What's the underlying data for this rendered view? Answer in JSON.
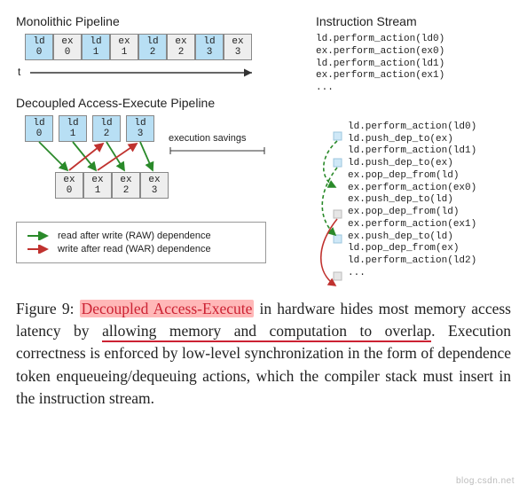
{
  "monolithic": {
    "title": "Monolithic Pipeline",
    "cells": [
      {
        "op": "ld",
        "idx": "0",
        "style": "blue"
      },
      {
        "op": "ex",
        "idx": "0",
        "style": "gray"
      },
      {
        "op": "ld",
        "idx": "1",
        "style": "blue"
      },
      {
        "op": "ex",
        "idx": "1",
        "style": "gray"
      },
      {
        "op": "ld",
        "idx": "2",
        "style": "blue"
      },
      {
        "op": "ex",
        "idx": "2",
        "style": "gray"
      },
      {
        "op": "ld",
        "idx": "3",
        "style": "blue"
      },
      {
        "op": "ex",
        "idx": "3",
        "style": "gray"
      }
    ],
    "time_label": "t"
  },
  "istream": {
    "title": "Instruction Stream",
    "lines": [
      "ld.perform_action(ld0)",
      "ex.perform_action(ex0)",
      "ld.perform_action(ld1)",
      "ex.perform_action(ex1)",
      "..."
    ]
  },
  "dae": {
    "title": "Decoupled Access-Execute Pipeline",
    "ld_cells": [
      {
        "op": "ld",
        "idx": "0"
      },
      {
        "op": "ld",
        "idx": "1"
      },
      {
        "op": "ld",
        "idx": "2"
      },
      {
        "op": "ld",
        "idx": "3"
      }
    ],
    "ex_cells": [
      {
        "op": "ex",
        "idx": "0"
      },
      {
        "op": "ex",
        "idx": "1"
      },
      {
        "op": "ex",
        "idx": "2"
      },
      {
        "op": "ex",
        "idx": "3"
      }
    ],
    "exec_savings_label": "execution savings"
  },
  "legend": {
    "raw": "read after write  (RAW) dependence",
    "war": "write after read  (WAR) dependence"
  },
  "istream2": {
    "lines": [
      "ld.perform_action(ld0)",
      "ld.push_dep_to(ex)",
      "ld.perform_action(ld1)",
      "ld.push_dep_to(ex)",
      "ex.pop_dep_from(ld)",
      "ex.perform_action(ex0)",
      "ex.push_dep_to(ld)",
      "ex.pop_dep_from(ld)",
      "ex.perform_action(ex1)",
      "ex.push_dep_to(ld)",
      "ld.pop_dep_from(ex)",
      "ld.perform_action(ld2)",
      "..."
    ]
  },
  "caption": {
    "fig_label": "Figure 9:",
    "hl": "Decoupled Access-Execute",
    "mid1": " in hardware hides most memory access latency by ",
    "ul": "allowing memory and computation to overlap",
    "rest": ".  Execution correctness is enforced by low-level synchronization in the form of dependence token enqueueing/dequeuing actions, which the compiler stack must insert in the instruction stream."
  },
  "colors": {
    "raw": "#2a8a2a",
    "war": "#c0322f",
    "blue": "#b8dff4",
    "gray": "#dddddd"
  },
  "watermark": "blog.csdn.net"
}
